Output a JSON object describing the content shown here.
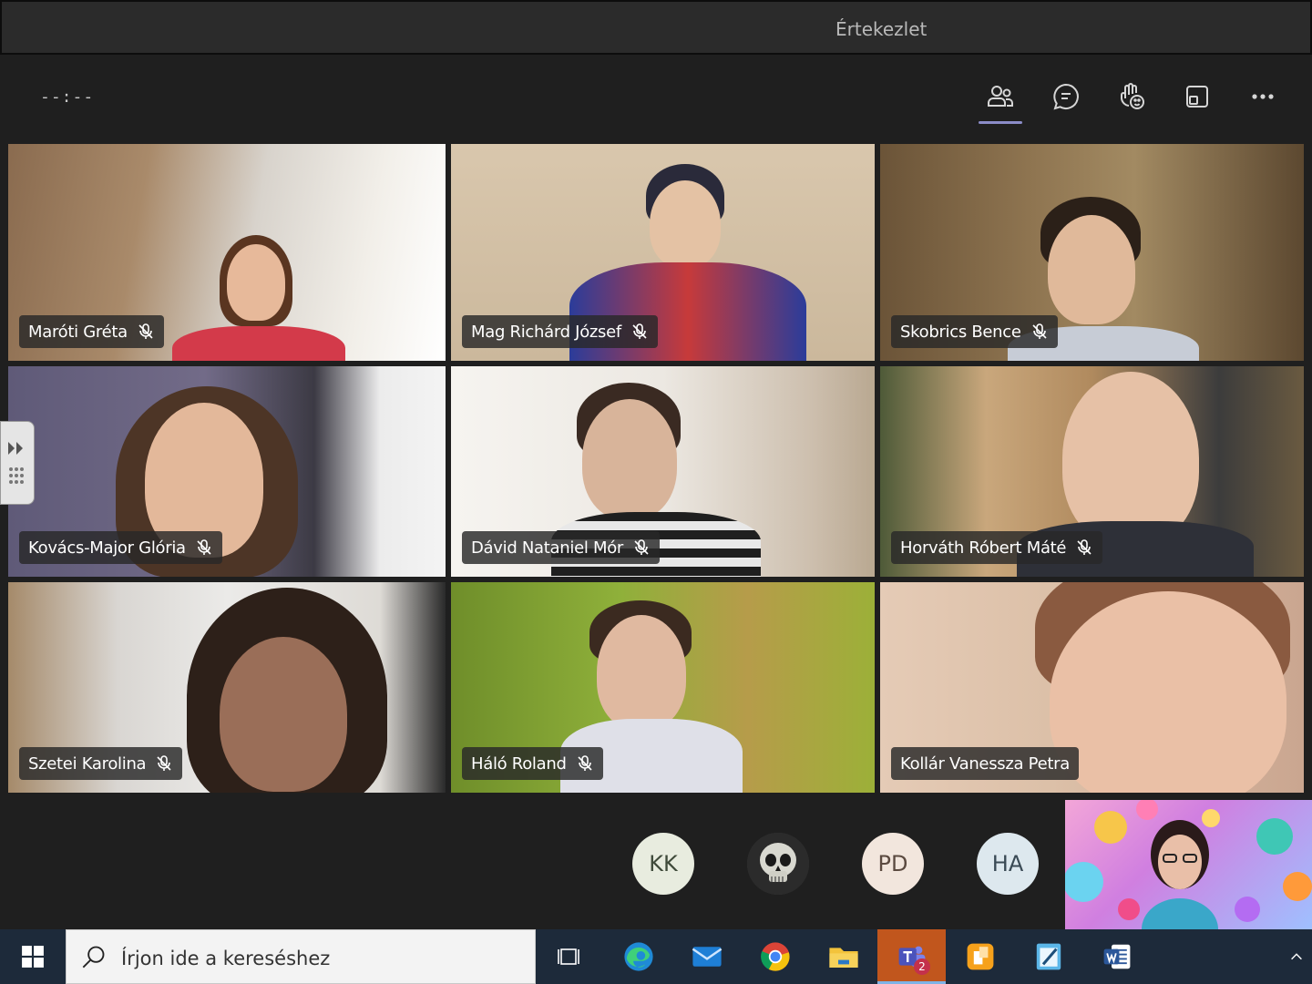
{
  "window": {
    "title": "Értekezlet"
  },
  "toolbar": {
    "timer": "--:--",
    "buttons": [
      {
        "name": "participants",
        "icon": "people-icon",
        "active": true
      },
      {
        "name": "chat",
        "icon": "chat-icon",
        "active": false
      },
      {
        "name": "reactions",
        "icon": "raise-hand-icon",
        "active": false
      },
      {
        "name": "share",
        "icon": "share-tray-icon",
        "active": false
      },
      {
        "name": "more",
        "icon": "more-icon",
        "active": false
      }
    ]
  },
  "participants": [
    {
      "name": "Maróti Gréta",
      "muted": true
    },
    {
      "name": "Mag Richárd József",
      "muted": true
    },
    {
      "name": "Skobrics Bence",
      "muted": true
    },
    {
      "name": "Kovács-Major Glória",
      "muted": true
    },
    {
      "name": "Dávid Nataniel Mór",
      "muted": true
    },
    {
      "name": "Horváth Róbert Máté",
      "muted": true
    },
    {
      "name": "Szetei Karolina",
      "muted": true
    },
    {
      "name": "Háló Roland",
      "muted": true
    },
    {
      "name": "Kollár Vanessza Petra",
      "muted": false
    }
  ],
  "avatars": [
    {
      "initials": "KK",
      "color": "#e8ecdf"
    },
    {
      "initials": "",
      "icon": "skull-icon",
      "color": "#444444"
    },
    {
      "initials": "PD",
      "color": "#f2e6dd"
    },
    {
      "initials": "HA",
      "color": "#dde8ee"
    }
  ],
  "taskbar": {
    "search_placeholder": "Írjon ide a kereséshez",
    "teams_badge": "2",
    "apps": [
      "task-view-icon",
      "edge-icon",
      "mail-icon",
      "chrome-icon",
      "file-explorer-icon",
      "teams-icon",
      "office-icon",
      "notepad-icon",
      "word-icon"
    ]
  },
  "colors": {
    "accent": "#8b8cc7",
    "taskbar": "#1d2a3a",
    "teams": "#c1561d"
  }
}
